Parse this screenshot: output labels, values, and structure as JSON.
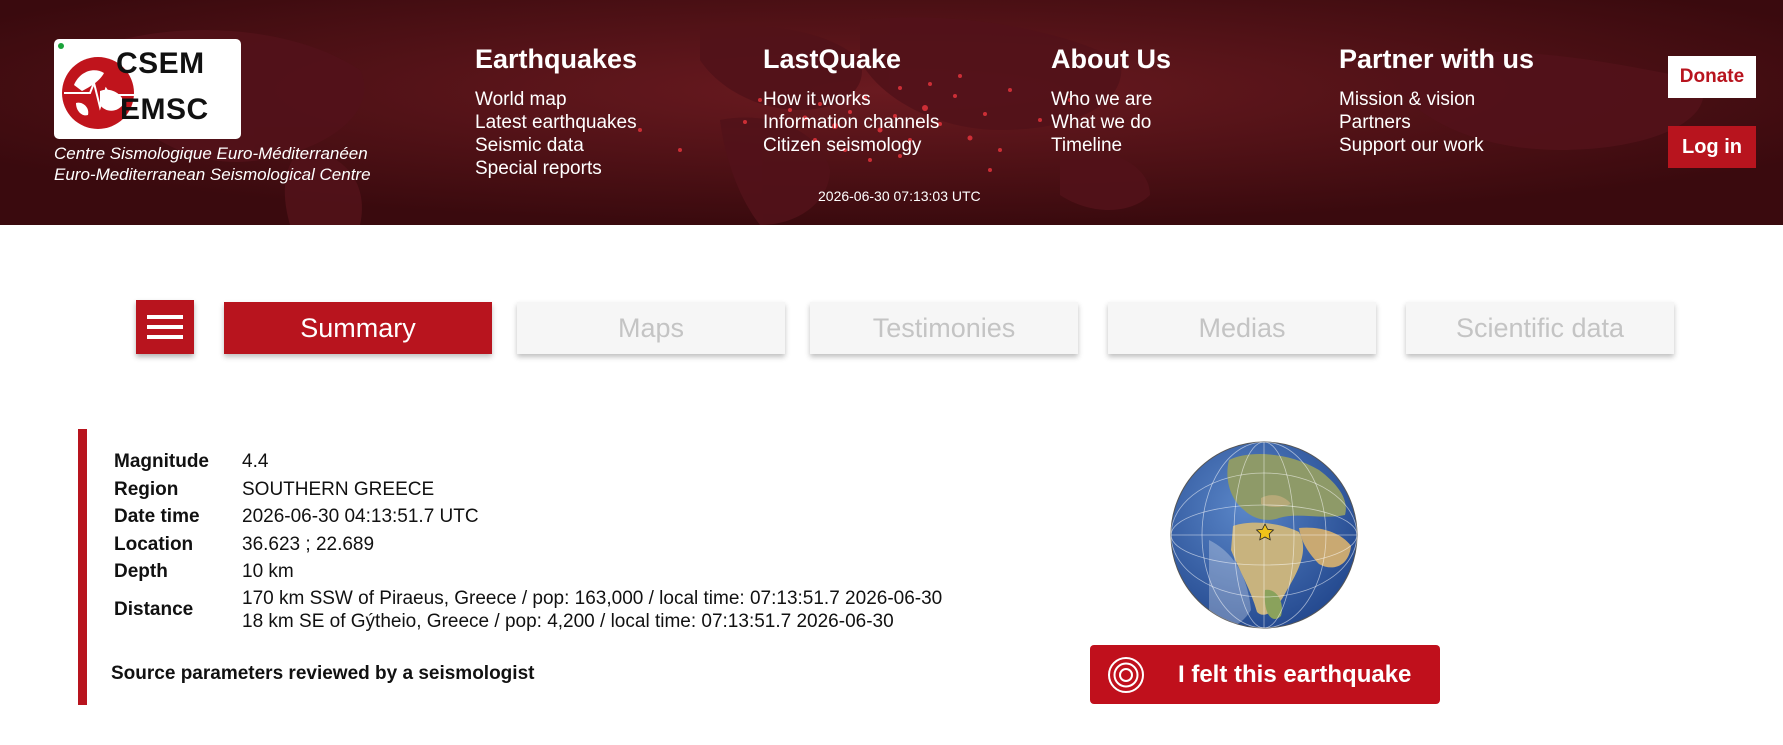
{
  "header": {
    "logo": {
      "line1": "CSEM",
      "line2": "EMSC"
    },
    "tagline": {
      "line1": "Centre Sismologique Euro-Méditerranéen",
      "line2": "Euro-Mediterranean Seismological Centre"
    },
    "nav": [
      {
        "title": "Earthquakes",
        "links": [
          "World map",
          "Latest earthquakes",
          "Seismic data",
          "Special reports"
        ]
      },
      {
        "title": "LastQuake",
        "links": [
          "How it works",
          "Information channels",
          "Citizen seismology"
        ]
      },
      {
        "title": "About Us",
        "links": [
          "Who we are",
          "What we do",
          "Timeline"
        ]
      },
      {
        "title": "Partner with us",
        "links": [
          "Mission & vision",
          "Partners",
          "Support our work"
        ]
      }
    ],
    "utc_time": "2026-06-30 07:13:03 UTC",
    "donate_label": "Donate",
    "login_label": "Log in",
    "colors": {
      "background": "#3d0b0f",
      "accent": "#b8141e"
    }
  },
  "tabs": {
    "menu_icon": "hamburger-icon",
    "items": [
      {
        "label": "Summary",
        "active": true
      },
      {
        "label": "Maps",
        "active": false
      },
      {
        "label": "Testimonies",
        "active": false
      },
      {
        "label": "Medias",
        "active": false
      },
      {
        "label": "Scientific data",
        "active": false
      }
    ]
  },
  "event": {
    "magnitude_label": "Magnitude",
    "magnitude": "4.4",
    "region_label": "Region",
    "region": "SOUTHERN GREECE",
    "datetime_label": "Date time",
    "datetime": "2026-06-30 04:13:51.7 UTC",
    "location_label": "Location",
    "location": "36.623 ; 22.689",
    "depth_label": "Depth",
    "depth": "10 km",
    "distance_label": "Distance",
    "distances": [
      "170 km SSW of Piraeus, Greece / pop: 163,000 / local time: 07:13:51.7 2026-06-30",
      "18 km SE of Gýtheio, Greece / pop: 4,200 / local time: 07:13:51.7 2026-06-30"
    ],
    "review_status": "Source parameters reviewed by a seismologist"
  },
  "felt_button": {
    "label": "I felt this earthquake",
    "icon": "target-icon"
  },
  "globe": {
    "icon": "globe-map",
    "marker": "star-icon"
  }
}
